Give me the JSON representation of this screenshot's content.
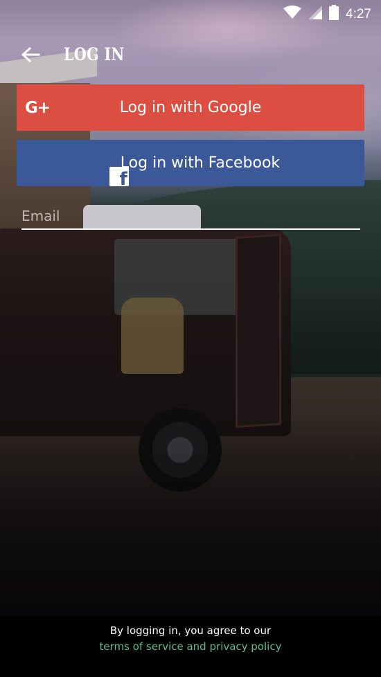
{
  "status_bar": {
    "time": "4:27",
    "icons": [
      "wifi-icon",
      "cell-signal-icon",
      "battery-icon"
    ]
  },
  "header": {
    "back_icon": "arrow-left-icon",
    "title": "LOG IN"
  },
  "google_button": {
    "icon": "google-plus-icon",
    "icon_text": "G+",
    "label": "Log in with Google",
    "color": "#dc4e41"
  },
  "facebook_button": {
    "icon": "facebook-icon",
    "icon_text": "f",
    "label": "Log in with Facebook",
    "color": "#3b5998"
  },
  "email": {
    "value": "",
    "placeholder": "Email"
  },
  "footer": {
    "agreement_text": "By logging in, you agree to our",
    "terms_link": "terms of service and privacy policy",
    "link_color": "#5bbf8c"
  }
}
